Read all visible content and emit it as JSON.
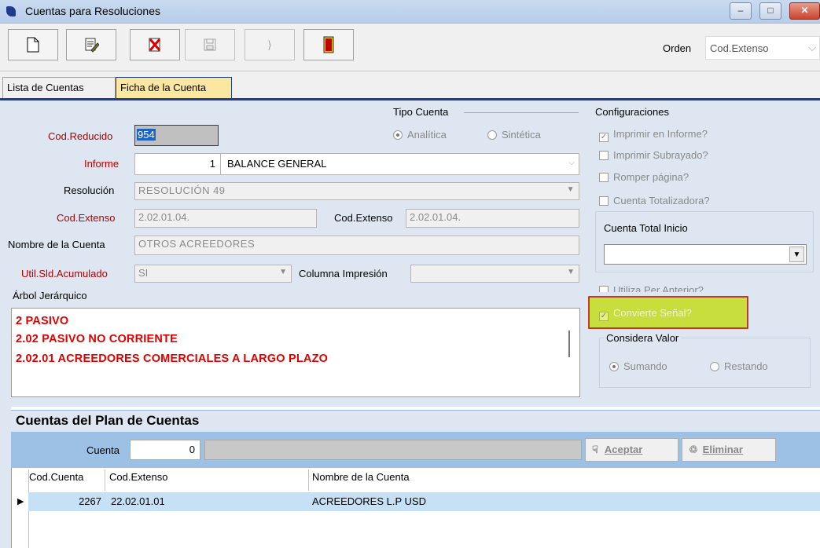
{
  "window": {
    "title": "Cuentas para Resoluciones",
    "min": "–",
    "max": "□",
    "close": "✕"
  },
  "toolbar": {
    "orden_label": "Orden",
    "orden_value": "Cod.Extenso"
  },
  "tabs": {
    "lista": "Lista de Cuentas",
    "ficha": "Ficha de la Cuenta"
  },
  "form": {
    "tipo_cuenta_label": "Tipo Cuenta",
    "analitica": "Analítica",
    "sintetica": "Sintética",
    "cod_reducido_label": "Cod.Reducido",
    "cod_reducido_value": "954",
    "informe_label": "Informe",
    "informe_num": "1",
    "informe_value": "BALANCE GENERAL",
    "resolucion_label": "Resolución",
    "resolucion_value": "RESOLUCIÓN 49",
    "cod_extenso_label": "Cod.Extenso",
    "cod_extenso_value": "2.02.01.04.",
    "cod_extenso2_label": "Cod.Extenso",
    "cod_extenso2_value": "2.02.01.04.",
    "nombre_label": "Nombre de la Cuenta",
    "nombre_value": "OTROS ACREEDORES",
    "util_label": "Util.Sld.Acumulado",
    "util_value": "SI",
    "columna_label": "Columna Impresión",
    "columna_value": "",
    "arbol_label": "Árbol Jerárquico",
    "arbol_lines": [
      "2  PASIVO",
      "2.02  PASIVO  NO CORRIENTE",
      "2.02.01  ACREEDORES COMERCIALES A LARGO PLAZO"
    ]
  },
  "config": {
    "title": "Configuraciones",
    "imprimir_informe": "Imprimir en Informe?",
    "imprimir_subrayado": "Imprimir Subrayado?",
    "romper_pagina": "Romper página?",
    "cuenta_totalizadora": "Cuenta Totalizadora?",
    "cuenta_total_inicio": "Cuenta Total Inicio",
    "utiliza_per": "Utiliza Per.Anterior?",
    "convierte_senal": "Convierte Señal?",
    "considera_valor": "Considera Valor",
    "sumando": "Sumando",
    "restando": "Restando"
  },
  "plan": {
    "title": "Cuentas del Plan de Cuentas",
    "cuenta_label": "Cuenta",
    "cuenta_value": "0",
    "aceptar": "Aceptar",
    "eliminar": "Eliminar",
    "columns": [
      "Cod.Cuenta",
      "Cod.Extenso",
      "Nombre de la Cuenta"
    ],
    "rows": [
      {
        "cod_cuenta": "2267",
        "cod_extenso": "22.02.01.01",
        "nombre": "ACREEDORES L.P USD"
      }
    ]
  },
  "colors": {
    "accent_tab": "#fbe6a2",
    "panel": "#dde6f1",
    "highlight": "#c8de3c",
    "arbol_text": "#e00000"
  }
}
